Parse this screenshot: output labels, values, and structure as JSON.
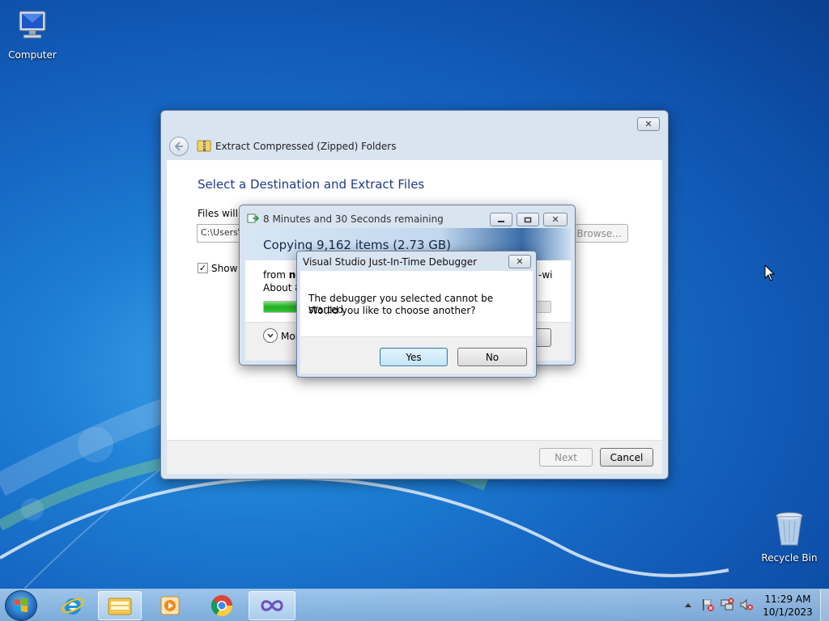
{
  "desktop": {
    "icons": [
      {
        "label": "Computer"
      },
      {
        "label": "Recycle Bin"
      }
    ]
  },
  "extract_window": {
    "title": "Extract Compressed (Zipped) Folders",
    "heading": "Select a Destination and Extract Files",
    "files_label": "Files will b",
    "path_value": "C:\\Users\\",
    "browse_label": "Browse...",
    "show_label": "Show e",
    "next_label": "Next",
    "cancel_label": "Cancel",
    "close_glyph": "✕"
  },
  "copy_window": {
    "title": "8 Minutes and 30 Seconds remaining",
    "heading": "Copying 9,162 items (2.73 GB)",
    "from_text": "from ",
    "from_bold": "no",
    "to_fragment": "-wi",
    "about_text": "About 8",
    "more_label": "Mor",
    "progress": 0.2
  },
  "debugger_dialog": {
    "title": "Visual Studio Just-In-Time Debugger",
    "message_line1": "The debugger you selected cannot be started.",
    "message_line2": "Would you like to choose another?",
    "yes_label": "Yes",
    "no_label": "No"
  },
  "taskbar": {
    "clock_time": "11:29 AM",
    "clock_date": "10/1/2023"
  }
}
